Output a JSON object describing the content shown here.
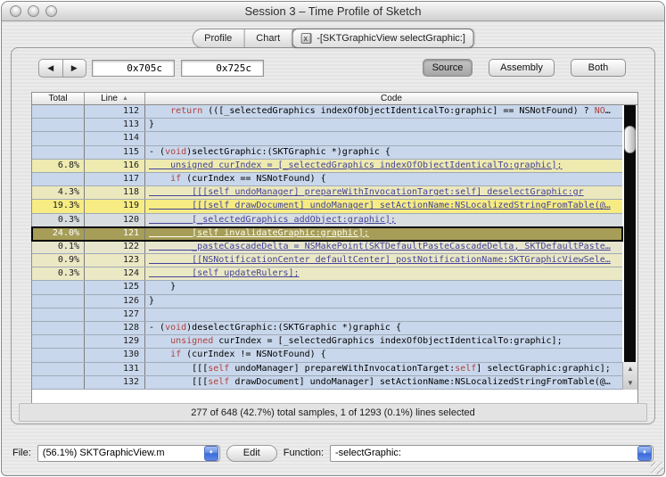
{
  "window": {
    "title": "Session 3 – Time Profile of Sketch"
  },
  "tabs": [
    {
      "label": "Profile",
      "active": false
    },
    {
      "label": "Chart",
      "active": false
    },
    {
      "label": "-[SKTGraphicView selectGraphic:]",
      "active": true,
      "close_icon": "x"
    }
  ],
  "toolbar": {
    "back_icon": "◀",
    "forward_icon": "▶",
    "address_fields": [
      {
        "value": "0x705c"
      },
      {
        "value": "0x725c"
      }
    ],
    "view_buttons": [
      {
        "label": "Source",
        "selected": true
      },
      {
        "label": "Assembly",
        "selected": false
      },
      {
        "label": "Both",
        "selected": false
      }
    ]
  },
  "table": {
    "columns": [
      "Total",
      "Line",
      "Code"
    ],
    "sort_icon": "▲",
    "keywords": [
      "return",
      "if",
      "unsigned",
      "void",
      "self",
      "NO"
    ],
    "keyword_color": "#b0413a",
    "link_color": "#42429a",
    "selected_row_color": "#a69d58",
    "rows": [
      {
        "line": 112,
        "total": "",
        "bg": "#c9d7ec",
        "link": false,
        "selected": false,
        "code": "    return (([_selectedGraphics indexOfObjectIdenticalTo:graphic] == NSNotFound) ? NO…"
      },
      {
        "line": 113,
        "total": "",
        "bg": "#c9d7ec",
        "link": false,
        "selected": false,
        "code": "}"
      },
      {
        "line": 114,
        "total": "",
        "bg": "#c9d7ec",
        "link": false,
        "selected": false,
        "code": ""
      },
      {
        "line": 115,
        "total": "",
        "bg": "#c9d7ec",
        "link": false,
        "selected": false,
        "code": "- (void)selectGraphic:(SKTGraphic *)graphic {"
      },
      {
        "line": 116,
        "total": "6.8%",
        "bg": "#eeeab0",
        "link": true,
        "selected": false,
        "code": "    unsigned curIndex = [_selectedGraphics indexOfObjectIdenticalTo:graphic];"
      },
      {
        "line": 117,
        "total": "",
        "bg": "#c9d7ec",
        "link": false,
        "selected": false,
        "code": "    if (curIndex == NSNotFound) {"
      },
      {
        "line": 118,
        "total": "4.3%",
        "bg": "#ece8bd",
        "link": true,
        "selected": false,
        "code": "        [[[self undoManager] prepareWithInvocationTarget:self] deselectGraphic:gr"
      },
      {
        "line": 119,
        "total": "19.3%",
        "bg": "#f6ec83",
        "link": true,
        "selected": false,
        "code": "        [[[self drawDocument] undoManager] setActionName:NSLocalizedStringFromTable(@…"
      },
      {
        "line": 120,
        "total": "0.3%",
        "bg": "#d8dde0",
        "link": true,
        "selected": false,
        "code": "        [_selectedGraphics addObject:graphic];"
      },
      {
        "line": 121,
        "total": "24.0%",
        "bg": "#a69d58",
        "link": true,
        "selected": true,
        "code": "        [self invalidateGraphic:graphic];"
      },
      {
        "line": 122,
        "total": "0.1%",
        "bg": "#e7e6cd",
        "link": true,
        "selected": false,
        "code": "        _pasteCascadeDelta = NSMakePoint(SKTDefaultPasteCascadeDelta, SKTDefaultPaste…"
      },
      {
        "line": 123,
        "total": "0.9%",
        "bg": "#ebe8c4",
        "link": true,
        "selected": false,
        "code": "        [[NSNotificationCenter defaultCenter] postNotificationName:SKTGraphicViewSele…"
      },
      {
        "line": 124,
        "total": "0.3%",
        "bg": "#ebe8c4",
        "link": true,
        "selected": false,
        "code": "        [self updateRulers];"
      },
      {
        "line": 125,
        "total": "",
        "bg": "#c9d7ec",
        "link": false,
        "selected": false,
        "code": "    }"
      },
      {
        "line": 126,
        "total": "",
        "bg": "#c9d7ec",
        "link": false,
        "selected": false,
        "code": "}"
      },
      {
        "line": 127,
        "total": "",
        "bg": "#c9d7ec",
        "link": false,
        "selected": false,
        "code": ""
      },
      {
        "line": 128,
        "total": "",
        "bg": "#c9d7ec",
        "link": false,
        "selected": false,
        "code": "- (void)deselectGraphic:(SKTGraphic *)graphic {"
      },
      {
        "line": 129,
        "total": "",
        "bg": "#c9d7ec",
        "link": false,
        "selected": false,
        "code": "    unsigned curIndex = [_selectedGraphics indexOfObjectIdenticalTo:graphic];"
      },
      {
        "line": 130,
        "total": "",
        "bg": "#c9d7ec",
        "link": false,
        "selected": false,
        "code": "    if (curIndex != NSNotFound) {"
      },
      {
        "line": 131,
        "total": "",
        "bg": "#c9d7ec",
        "link": false,
        "selected": false,
        "code": "        [[[self undoManager] prepareWithInvocationTarget:self] selectGraphic:graphic];"
      },
      {
        "line": 132,
        "total": "",
        "bg": "#c9d7ec",
        "link": false,
        "selected": false,
        "code": "        [[[self drawDocument] undoManager] setActionName:NSLocalizedStringFromTable(@…"
      }
    ]
  },
  "scrollbar": {
    "up_icon": "▲",
    "down_icon": "▼"
  },
  "status_bar": {
    "text": "277 of 648 (42.7%) total samples, 1 of 1293 (0.1%) lines selected"
  },
  "footer": {
    "file_label": "File:",
    "file_value": "(56.1%) SKTGraphicView.m",
    "edit_label": "Edit",
    "function_label": "Function:",
    "function_value": "-selectGraphic:",
    "dropdown_icon": "▼"
  }
}
